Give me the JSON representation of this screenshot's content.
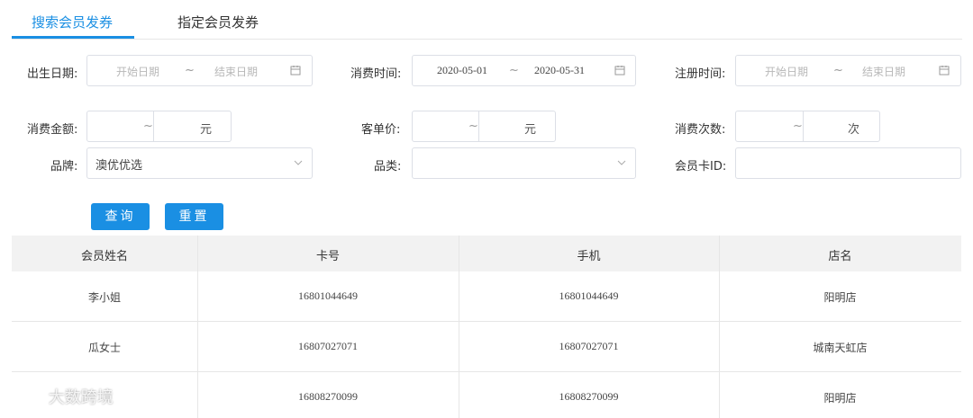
{
  "tabs": [
    {
      "label": "搜索会员发券",
      "active": true
    },
    {
      "label": "指定会员发券",
      "active": false
    }
  ],
  "filters": {
    "birth_date": {
      "label": "出生日期:",
      "start_placeholder": "开始日期",
      "separator": "~",
      "end_placeholder": "结束日期"
    },
    "consume_time": {
      "label": "消费时间:",
      "start_value": "2020-05-01",
      "separator": "~",
      "end_value": "2020-05-31"
    },
    "register_time": {
      "label": "注册时间:",
      "start_placeholder": "开始日期",
      "separator": "~",
      "end_placeholder": "结束日期"
    },
    "consume_amount": {
      "label": "消费金额:",
      "separator": "~",
      "unit": "元"
    },
    "avg_price": {
      "label": "客单价:",
      "separator": "~",
      "unit": "元"
    },
    "consume_count": {
      "label": "消费次数:",
      "separator": "~",
      "unit": "次"
    },
    "brand": {
      "label": "品牌:",
      "value": "澳优优选"
    },
    "category": {
      "label": "品类:",
      "value": ""
    },
    "card_id": {
      "label": "会员卡ID:",
      "value": ""
    }
  },
  "buttons": {
    "query": "查询",
    "reset": "重置"
  },
  "table": {
    "columns": [
      "会员姓名",
      "卡号",
      "手机",
      "店名"
    ],
    "rows": [
      [
        "李小姐",
        "16801044649",
        "16801044649",
        "阳明店"
      ],
      [
        "瓜女士",
        "16807027071",
        "16807027071",
        "城南天虹店"
      ],
      [
        "",
        "16808270099",
        "16808270099",
        "阳明店"
      ]
    ]
  },
  "watermark": "大数跨境",
  "colors": {
    "accent": "#1a8fe3",
    "header_bg": "#f2f2f2",
    "border": "#dcdfe6"
  }
}
